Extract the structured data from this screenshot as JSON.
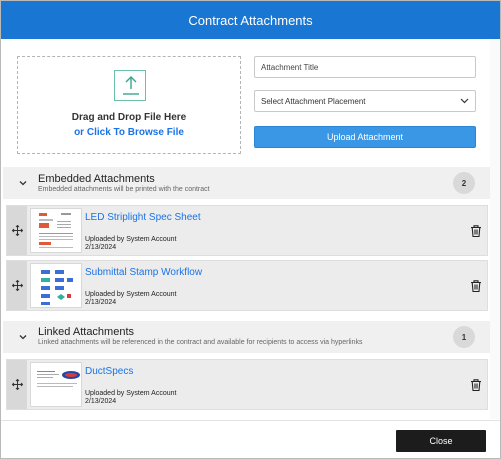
{
  "modal": {
    "title": "Contract Attachments"
  },
  "dropzone": {
    "line1": "Drag and Drop File Here",
    "line2": "or Click To Browse File",
    "icon": "upload-icon"
  },
  "form": {
    "title_placeholder": "Attachment Title",
    "title_value": "",
    "placement_selected": "Select Attachment Placement",
    "upload_label": "Upload Attachment"
  },
  "embedded": {
    "title": "Embedded Attachments",
    "description": "Embedded attachments will be printed with the contract",
    "count": "2",
    "items": [
      {
        "title": "LED Striplight Spec Sheet",
        "uploaded_by": "Uploaded by System Account",
        "date": "2/13/2024"
      },
      {
        "title": "Submittal Stamp Workflow",
        "uploaded_by": "Uploaded by System Account",
        "date": "2/13/2024"
      }
    ]
  },
  "linked": {
    "title": "Linked Attachments",
    "description": "Linked attachments will be referenced in the contract and available for recipients to access via hyperlinks",
    "count": "1",
    "items": [
      {
        "title": "DuctSpecs",
        "uploaded_by": "Uploaded by System Account",
        "date": "2/13/2024"
      }
    ]
  },
  "footer": {
    "close_label": "Close"
  },
  "colors": {
    "header": "#1976d2",
    "link": "#1a73e8",
    "upload_button": "#3a97e6",
    "close_button": "#1c1c1c",
    "section_bg": "#f0f0f0"
  }
}
